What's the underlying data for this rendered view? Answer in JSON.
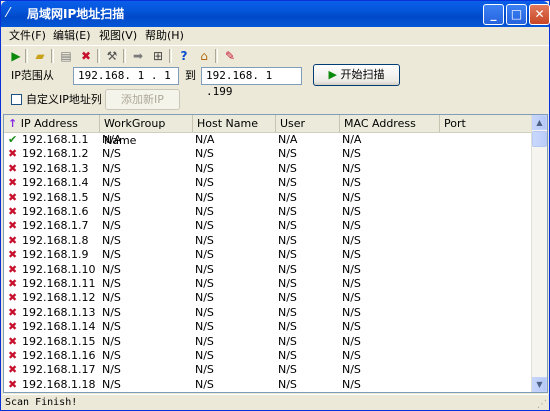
{
  "window": {
    "title": "局域网IP地址扫描",
    "controls": {
      "minimize": "_",
      "maximize": "□",
      "close": "✕"
    }
  },
  "menu": [
    {
      "label": "文件(F)"
    },
    {
      "label": "编辑(E)"
    },
    {
      "label": "视图(V)"
    },
    {
      "label": "帮助(H)"
    }
  ],
  "toolbar": {
    "icons": [
      "run-icon",
      "open-folder-icon",
      "save-icon",
      "delete-icon",
      "tools-icon",
      "send-icon",
      "network-icon",
      "help-icon",
      "home-icon",
      "settings-icon"
    ]
  },
  "range": {
    "label": "IP范围从",
    "start": "192.168. 1 . 1",
    "to_label": "到",
    "end": "192.168. 1 .199",
    "scan_button": "开始扫描"
  },
  "custom": {
    "checkbox_label": "自定义IP地址列",
    "add_button": "添加新IP",
    "checked": false
  },
  "table": {
    "columns": [
      "IP Address",
      "WorkGroup Name",
      "Host Name",
      "User",
      "MAC Address",
      "Port"
    ],
    "rows": [
      {
        "status": "ok",
        "ip": "192.168.1.1",
        "workgroup": "N/A",
        "host": "N/A",
        "user": "N/A",
        "mac": "N/A",
        "port": ""
      },
      {
        "status": "fail",
        "ip": "192.168.1.2",
        "workgroup": "N/S",
        "host": "N/S",
        "user": "N/S",
        "mac": "N/S",
        "port": ""
      },
      {
        "status": "fail",
        "ip": "192.168.1.3",
        "workgroup": "N/S",
        "host": "N/S",
        "user": "N/S",
        "mac": "N/S",
        "port": ""
      },
      {
        "status": "fail",
        "ip": "192.168.1.4",
        "workgroup": "N/S",
        "host": "N/S",
        "user": "N/S",
        "mac": "N/S",
        "port": ""
      },
      {
        "status": "fail",
        "ip": "192.168.1.5",
        "workgroup": "N/S",
        "host": "N/S",
        "user": "N/S",
        "mac": "N/S",
        "port": ""
      },
      {
        "status": "fail",
        "ip": "192.168.1.6",
        "workgroup": "N/S",
        "host": "N/S",
        "user": "N/S",
        "mac": "N/S",
        "port": ""
      },
      {
        "status": "fail",
        "ip": "192.168.1.7",
        "workgroup": "N/S",
        "host": "N/S",
        "user": "N/S",
        "mac": "N/S",
        "port": ""
      },
      {
        "status": "fail",
        "ip": "192.168.1.8",
        "workgroup": "N/S",
        "host": "N/S",
        "user": "N/S",
        "mac": "N/S",
        "port": ""
      },
      {
        "status": "fail",
        "ip": "192.168.1.9",
        "workgroup": "N/S",
        "host": "N/S",
        "user": "N/S",
        "mac": "N/S",
        "port": ""
      },
      {
        "status": "fail",
        "ip": "192.168.1.10",
        "workgroup": "N/S",
        "host": "N/S",
        "user": "N/S",
        "mac": "N/S",
        "port": ""
      },
      {
        "status": "fail",
        "ip": "192.168.1.11",
        "workgroup": "N/S",
        "host": "N/S",
        "user": "N/S",
        "mac": "N/S",
        "port": ""
      },
      {
        "status": "fail",
        "ip": "192.168.1.12",
        "workgroup": "N/S",
        "host": "N/S",
        "user": "N/S",
        "mac": "N/S",
        "port": ""
      },
      {
        "status": "fail",
        "ip": "192.168.1.13",
        "workgroup": "N/S",
        "host": "N/S",
        "user": "N/S",
        "mac": "N/S",
        "port": ""
      },
      {
        "status": "fail",
        "ip": "192.168.1.14",
        "workgroup": "N/S",
        "host": "N/S",
        "user": "N/S",
        "mac": "N/S",
        "port": ""
      },
      {
        "status": "fail",
        "ip": "192.168.1.15",
        "workgroup": "N/S",
        "host": "N/S",
        "user": "N/S",
        "mac": "N/S",
        "port": ""
      },
      {
        "status": "fail",
        "ip": "192.168.1.16",
        "workgroup": "N/S",
        "host": "N/S",
        "user": "N/S",
        "mac": "N/S",
        "port": ""
      },
      {
        "status": "fail",
        "ip": "192.168.1.17",
        "workgroup": "N/S",
        "host": "N/S",
        "user": "N/S",
        "mac": "N/S",
        "port": ""
      },
      {
        "status": "fail",
        "ip": "192.168.1.18",
        "workgroup": "N/S",
        "host": "N/S",
        "user": "N/S",
        "mac": "N/S",
        "port": ""
      }
    ]
  },
  "status": {
    "text": "Scan Finish!"
  },
  "colors": {
    "titlebar": "#0454d8",
    "ok": "#1a8d1a",
    "fail": "#c8102e",
    "sort_arrow": "#8a2be2"
  }
}
